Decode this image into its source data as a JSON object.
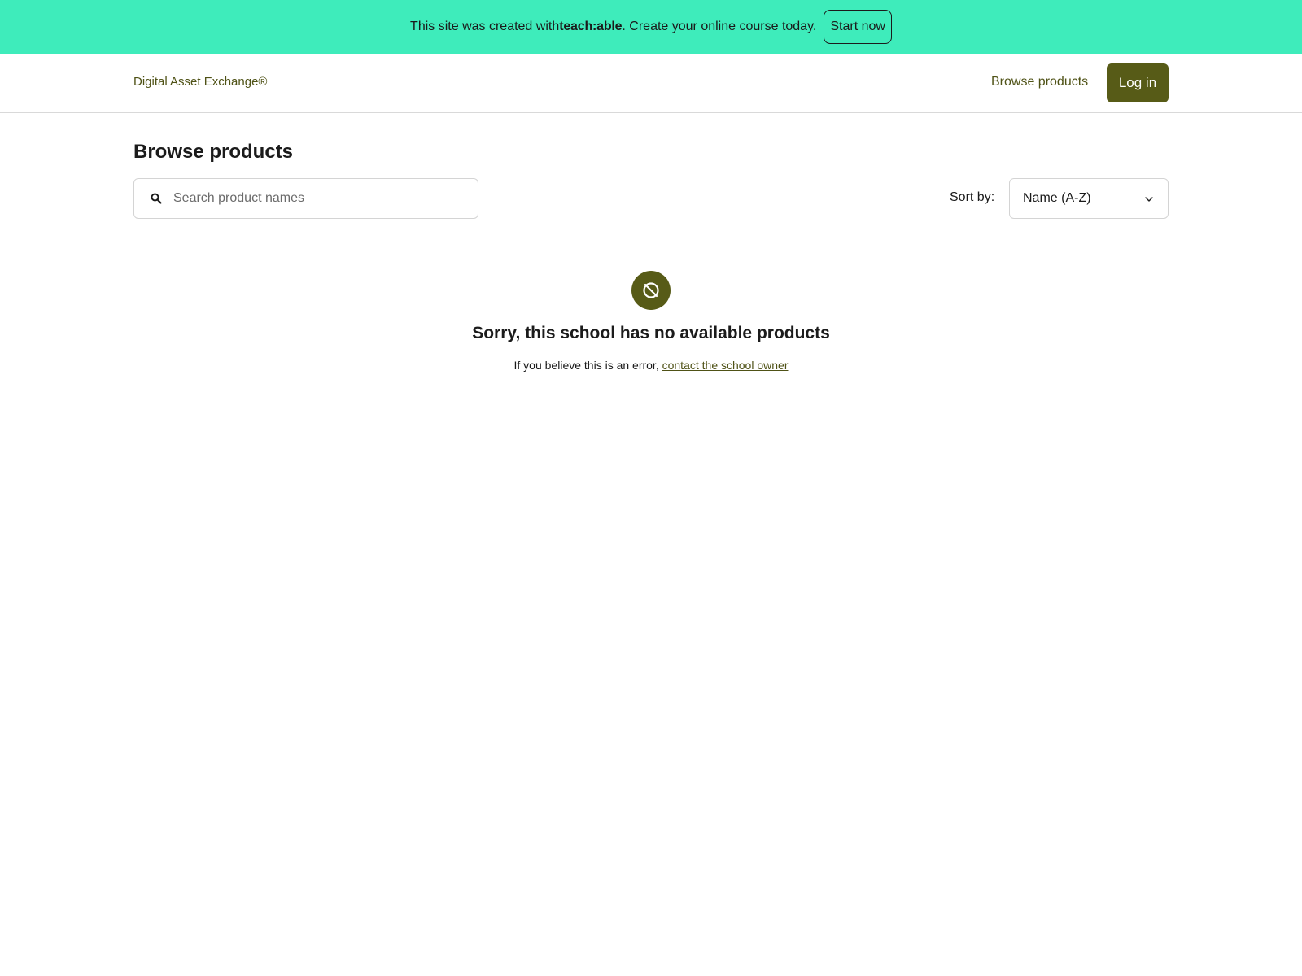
{
  "promo_banner": {
    "text_before": "This site was created with ",
    "brand": "teach:able",
    "text_after": ". Create your online course today.",
    "cta_label": "Start now"
  },
  "header": {
    "brand": "Digital Asset Exchange®",
    "nav_browse": "Browse products",
    "login_label": "Log in"
  },
  "main": {
    "title": "Browse products",
    "search": {
      "placeholder": "Search product names",
      "value": ""
    },
    "sort": {
      "label": "Sort by:",
      "selected": "Name (A-Z)"
    },
    "empty_state": {
      "icon": "no-products-icon",
      "heading": "Sorry, this school has no available products",
      "message_prefix": "If you believe this is an error, ",
      "link_label": "contact the school owner"
    }
  },
  "colors": {
    "banner_bg": "#3eecbb",
    "brand_accent": "#575b17",
    "link": "#4f5216"
  }
}
